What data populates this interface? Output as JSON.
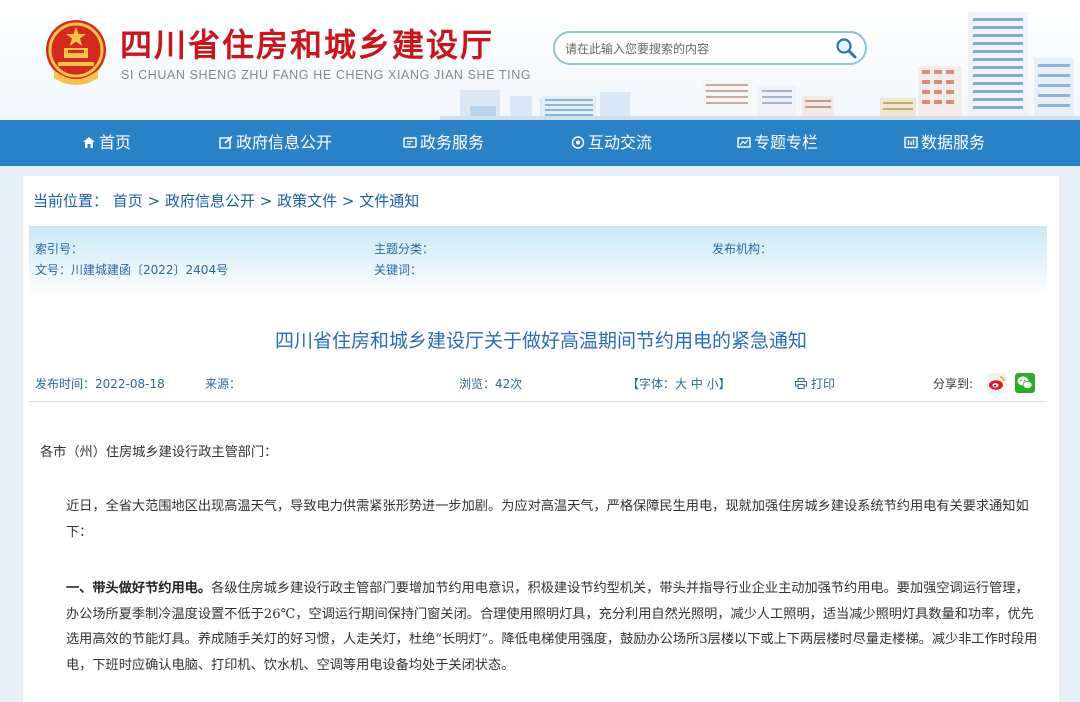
{
  "header": {
    "title": "四川省住房和城乡建设厅",
    "subtitle": "SI CHUAN SHENG ZHU FANG HE CHENG XIANG JIAN SHE TING",
    "emblem_icon": "national-emblem-icon",
    "search": {
      "placeholder": "请在此输入您要搜索的内容",
      "icon": "search-icon"
    }
  },
  "nav": {
    "items": [
      {
        "label": "首页",
        "icon": "home-icon"
      },
      {
        "label": "政府信息公开",
        "icon": "edit-icon"
      },
      {
        "label": "政务服务",
        "icon": "service-icon"
      },
      {
        "label": "互动交流",
        "icon": "interact-icon"
      },
      {
        "label": "专题专栏",
        "icon": "topic-icon"
      },
      {
        "label": "数据服务",
        "icon": "data-icon"
      }
    ],
    "bg_color": "#2a82c6"
  },
  "breadcrumb": {
    "prefix": "当前位置：",
    "items": [
      "首页",
      "政府信息公开",
      "政策文件",
      "文件通知"
    ],
    "separator": ">"
  },
  "meta": {
    "index_label": "索引号：",
    "subject_label": "主题分类：",
    "publisher_label": "发布机构：",
    "doc_no": "文号：川建城建函〔2022〕2404号",
    "keywords_label": "关键词："
  },
  "article": {
    "title": "四川省住房和城乡建设厅关于做好高温期间节约用电的紧急通知",
    "publish_time": "发布时间：2022-08-18",
    "source_label": "来源：",
    "views": "浏览：42次",
    "font_size": "【字体：大 中 小】",
    "print": "打印",
    "share_label": "分享到:",
    "share_icons": [
      "weibo-icon",
      "wechat-icon"
    ],
    "salutation": "各市（州）住房城乡建设行政主管部门：",
    "para1": "近日，全省大范围地区出现高温天气，导致电力供需紧张形势进一步加剧。为应对高温天气，严格保障民生用电，现就加强住房城乡建设系统节约用电有关要求通知如下：",
    "para2_heading": "一、带头做好节约用电。",
    "para2": "各级住房城乡建设行政主管部门要增加节约用电意识，积极建设节约型机关，带头并指导行业企业主动加强节约用电。要加强空调运行管理，办公场所夏季制冷温度设置不低于26℃，空调运行期间保持门窗关闭。合理使用照明灯具，充分利用自然光照明，减少人工照明，适当减少照明灯具数量和功率，优先选用高效的节能灯具。养成随手关灯的好习惯，人走关灯，杜绝“长明灯”。降低电梯使用强度，鼓励办公场所3层楼以下或上下两层楼时尽量走楼梯。减少非工作时段用电，下班时应确认电脑、打印机、饮水机、空调等用电设备均处于关闭状态。"
  },
  "colors": {
    "title_red": "#c8161d",
    "link_blue": "#1a5ea8",
    "heading_blue": "#2b6cb8"
  }
}
